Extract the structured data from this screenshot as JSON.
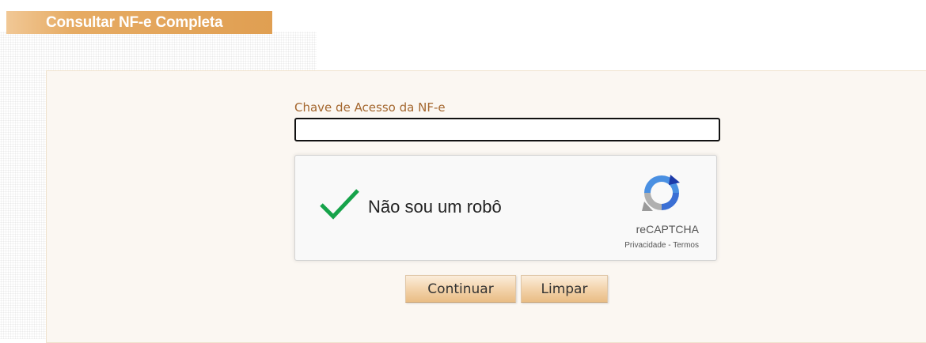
{
  "header": {
    "title": "Consultar NF-e Completa"
  },
  "form": {
    "access_key_label": "Chave de Acesso da NF-e",
    "access_key_value": ""
  },
  "recaptcha": {
    "status_label": "Não sou um robô",
    "checked": true,
    "brand": "reCAPTCHA",
    "privacy_label": "Privacidade",
    "separator": " - ",
    "terms_label": "Termos",
    "check_icon": "check-icon",
    "logo_icon": "recaptcha-logo-icon"
  },
  "actions": {
    "continue_label": "Continuar",
    "clear_label": "Limpar"
  },
  "colors": {
    "header_bar": "#e09f52",
    "label_text": "#a4672f",
    "panel_bg": "#fbf7f2",
    "check_green": "#16a34a",
    "button_bg": "#f4d6b0"
  }
}
